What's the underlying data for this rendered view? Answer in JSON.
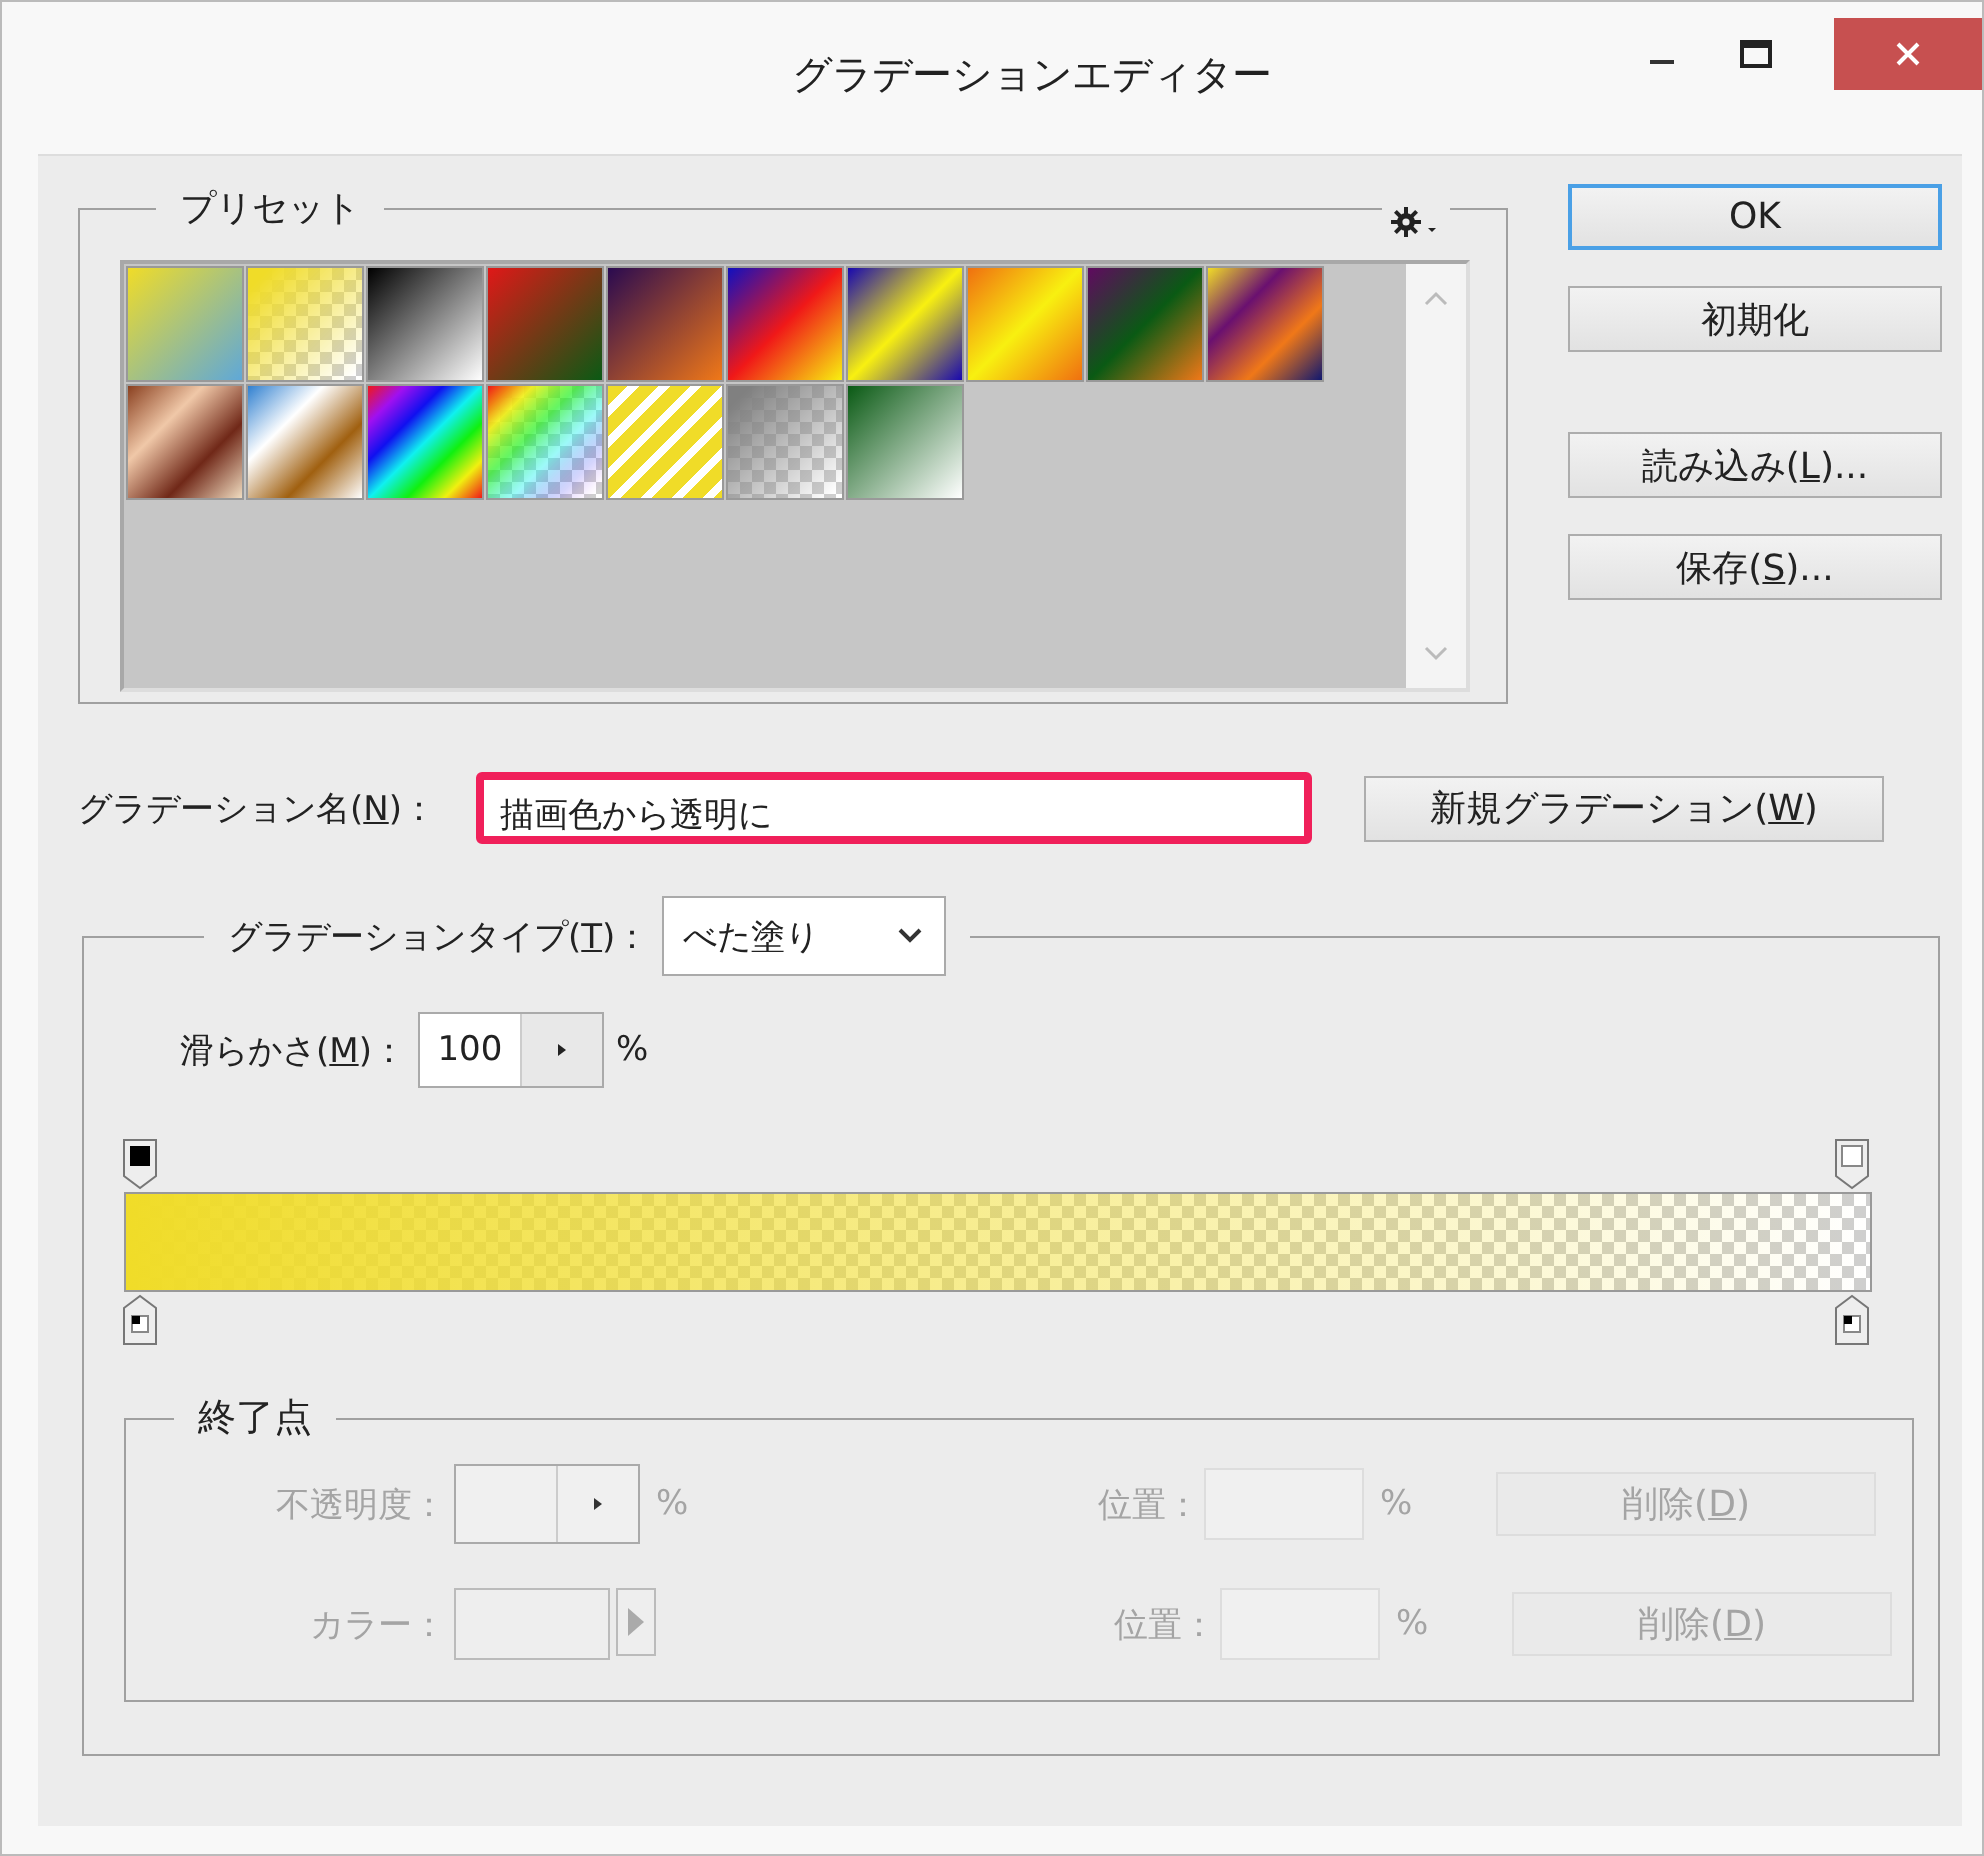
{
  "window": {
    "title": "グラデーションエディター"
  },
  "presets": {
    "label": "プリセット"
  },
  "buttons": [
    {
      "text": "OK",
      "default": true
    },
    {
      "text": "初期化",
      "default": false
    },
    {
      "text": "読み込み(",
      "key": "L",
      "after": ")...",
      "default": false
    },
    {
      "text": "保存(",
      "key": "S",
      "after": ")...",
      "default": false
    }
  ],
  "gradient_name": {
    "label": {
      "text": "グラデーション名(",
      "key": "N",
      "after": ")："
    },
    "value": "描画色から透明に",
    "highlighted": true
  },
  "new_button": {
    "text": "新規グラデーション(",
    "key": "W",
    "after": ")"
  },
  "gradient_type": {
    "label": {
      "text": "グラデーションタイプ(",
      "key": "T",
      "after": ")："
    },
    "value": "べた塗り"
  },
  "smoothness": {
    "label": {
      "text": "滑らかさ(",
      "key": "M",
      "after": ")："
    },
    "value": "100",
    "unit": "%"
  },
  "stops": {
    "title": "終了点",
    "disabled": true,
    "rows": [
      {
        "kind": "opacity",
        "label": "不透明度：",
        "unit": "%",
        "position_label": "位置：",
        "position_unit": "%",
        "delete": {
          "text": "削除(",
          "key": "D",
          "after": ")"
        }
      },
      {
        "kind": "color",
        "label": "カラー：",
        "position_label": "位置：",
        "position_unit": "%",
        "delete": {
          "text": "削除(",
          "key": "D",
          "after": ")"
        }
      }
    ]
  }
}
